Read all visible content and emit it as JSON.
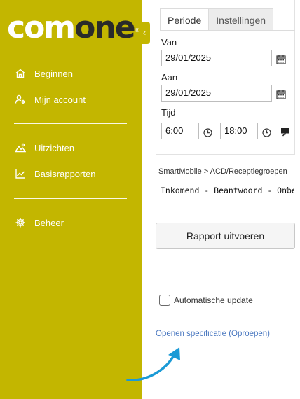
{
  "brand": {
    "logo_part1": "com",
    "logo_part2": "one",
    "registered": "®"
  },
  "sidebar": {
    "collapse_glyph": "‹",
    "items": [
      {
        "label": "Beginnen",
        "icon": "home-icon"
      },
      {
        "label": "Mijn account",
        "icon": "user-settings-icon"
      },
      {
        "label": "Uitzichten",
        "icon": "landscape-icon"
      },
      {
        "label": "Basisrapporten",
        "icon": "line-chart-icon"
      },
      {
        "label": "Beheer",
        "icon": "gear-icon"
      }
    ]
  },
  "tabs": [
    {
      "label": "Periode",
      "active": true
    },
    {
      "label": "Instellingen",
      "active": false
    }
  ],
  "form": {
    "from_label": "Van",
    "from_value": "29/01/2025",
    "to_label": "Aan",
    "to_value": "29/01/2025",
    "time_label": "Tijd",
    "time_from": "6:00",
    "time_to": "18:00"
  },
  "report": {
    "breadcrumb": "SmartMobile > ACD/Receptiegroepen",
    "selected": "Inkomend - Beantwoord - Onbeantwoord",
    "run_button": "Rapport uitvoeren"
  },
  "auto_update": {
    "label": "Automatische update",
    "checked": false
  },
  "spec_link": "Openen specificatie (Oproepen)",
  "colors": {
    "sidebar": "#c3b600",
    "link": "#4a78c0",
    "arrow": "#1a9ad6"
  }
}
